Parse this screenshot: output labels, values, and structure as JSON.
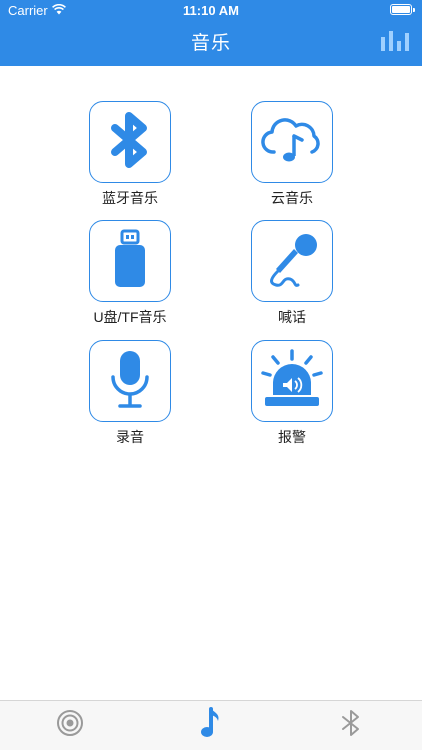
{
  "status_bar": {
    "carrier": "Carrier",
    "time": "11:10 AM"
  },
  "nav": {
    "title": "音乐"
  },
  "tiles": [
    {
      "label": "蓝牙音乐",
      "icon": "bluetooth-icon"
    },
    {
      "label": "云音乐",
      "icon": "cloud-music-icon"
    },
    {
      "label": "U盘/TF音乐",
      "icon": "usb-drive-icon"
    },
    {
      "label": "喊话",
      "icon": "microphone-handheld-icon"
    },
    {
      "label": "录音",
      "icon": "microphone-icon"
    },
    {
      "label": "报警",
      "icon": "alarm-siren-icon"
    }
  ],
  "tabs": [
    {
      "name": "radio",
      "icon": "target-icon",
      "active": false
    },
    {
      "name": "music",
      "icon": "music-note-icon",
      "active": true
    },
    {
      "name": "bluetooth",
      "icon": "bluetooth-icon",
      "active": false
    }
  ],
  "colors": {
    "primary": "#2f8ae6",
    "inactive_tab": "#9a9a9a"
  }
}
